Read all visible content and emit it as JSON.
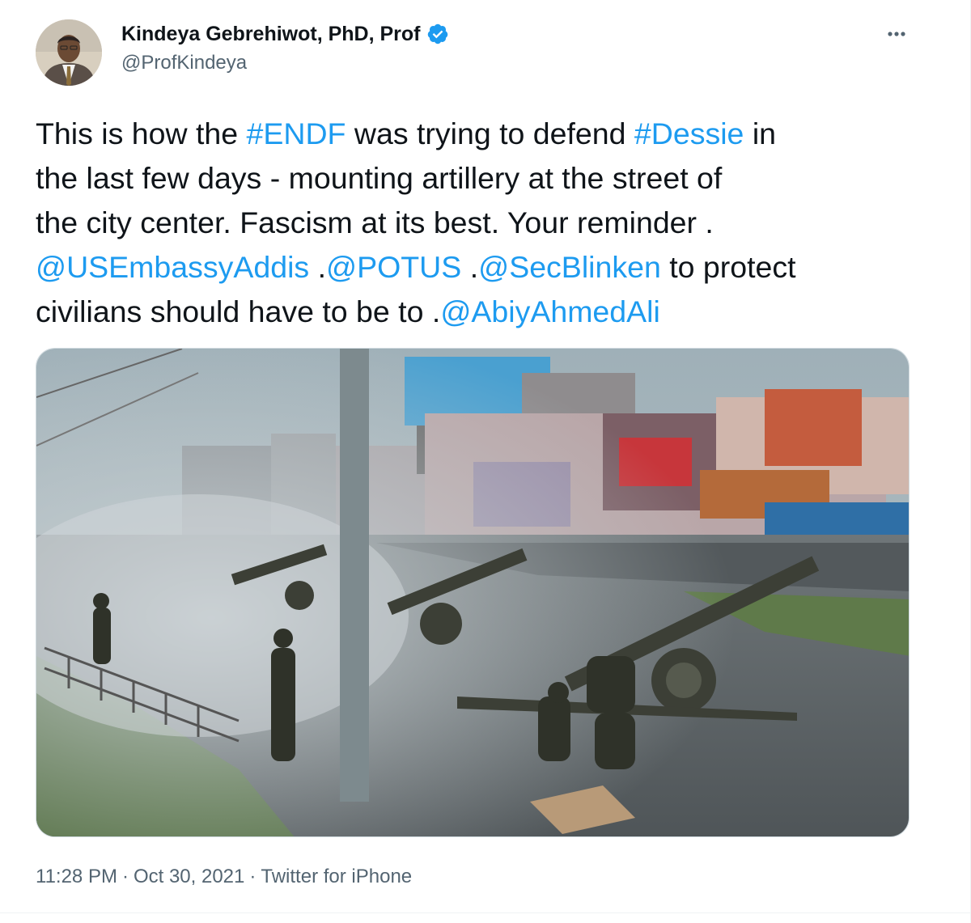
{
  "author": {
    "display_name": "Kindeya Gebrehiwot, PhD, Prof",
    "handle": "@ProfKindeya",
    "verified_icon": "verified-badge-icon",
    "avatar_icon": "profile-photo"
  },
  "more_icon": "more-options-icon",
  "tweet": {
    "segments": {
      "l1_a": "This is how the ",
      "l1_b": "#ENDF",
      "l1_c": " was trying to defend ",
      "l1_d": "#Dessie",
      "l1_e": " in",
      "l2": "the last few days - mounting artillery at the street of",
      "l3": "the city center. Fascism at its best. Your reminder .",
      "l4_a": "@USEmbassyAddis",
      "l4_b": " .",
      "l4_c": "@POTUS",
      "l4_d": " .",
      "l4_e": "@SecBlinken",
      "l4_f": " to protect",
      "l5_a": "civilians should have to be to .",
      "l5_b": "@AbiyAhmedAli"
    }
  },
  "media": {
    "description_icon": "artillery-street-photo"
  },
  "meta": {
    "time": "11:28 PM",
    "separator": "·",
    "date": "Oct 30, 2021",
    "source": "Twitter for iPhone"
  },
  "colors": {
    "link": "#1d9bf0",
    "text": "#0f1419",
    "secondary": "#536471",
    "verified": "#1d9bf0"
  }
}
